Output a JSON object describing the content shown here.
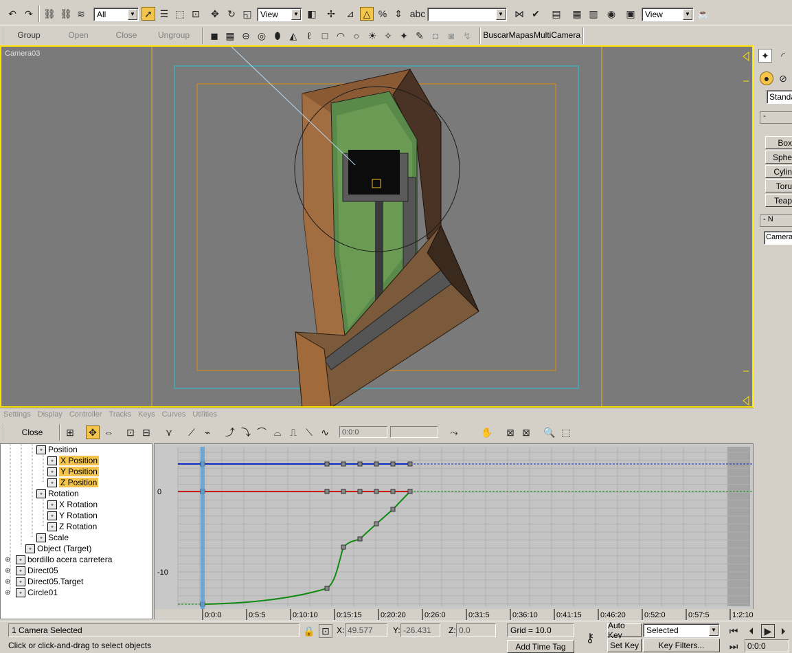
{
  "toolbar_main": {
    "selection_filter": "All",
    "ref_coord": "View",
    "named_selection": "",
    "ref_coord2": "View"
  },
  "toolbar_group": {
    "group": "Group",
    "open": "Open",
    "close": "Close",
    "ungroup": "Ungroup",
    "buscar_mapas": "BuscarMapas",
    "multi_camera": "MultiCamera"
  },
  "viewport": {
    "label": "Camera03"
  },
  "command_panel": {
    "dropdown": "Standa",
    "rollout1_title": "-",
    "buttons": [
      "Box",
      "Sphe",
      "Cylin",
      "Toru",
      "Teap"
    ],
    "rollout2_title": "- N",
    "name_field": "Camera0"
  },
  "track_view_menu": [
    "Settings",
    "Display",
    "Controller",
    "Tracks",
    "Keys",
    "Curves",
    "Utilities"
  ],
  "track_view_toolbar": {
    "close": "Close",
    "frame_field": "0:0:0",
    "value_field": ""
  },
  "tree": [
    {
      "label": "Position",
      "highlight": false,
      "indent": 52
    },
    {
      "label": "X Position",
      "highlight": true,
      "indent": 68
    },
    {
      "label": "Y Position",
      "highlight": true,
      "indent": 68
    },
    {
      "label": "Z Position",
      "highlight": true,
      "indent": 68
    },
    {
      "label": "Rotation",
      "highlight": false,
      "indent": 52
    },
    {
      "label": "X Rotation",
      "highlight": false,
      "indent": 68
    },
    {
      "label": "Y Rotation",
      "highlight": false,
      "indent": 68
    },
    {
      "label": "Z Rotation",
      "highlight": false,
      "indent": 68
    },
    {
      "label": "Scale",
      "highlight": false,
      "indent": 52
    },
    {
      "label": "Object (Target)",
      "highlight": false,
      "indent": 36
    },
    {
      "label": "bordillo acera carretera",
      "highlight": false,
      "indent": 22
    },
    {
      "label": "Direct05",
      "highlight": false,
      "indent": 22
    },
    {
      "label": "Direct05.Target",
      "highlight": false,
      "indent": 22
    },
    {
      "label": "Circle01",
      "highlight": false,
      "indent": 22
    }
  ],
  "curve_editor": {
    "y_labels": [
      "0",
      "-10"
    ],
    "x_ticks": [
      "0:0:0",
      "0:5:5",
      "0:10:10",
      "0:15:15",
      "0:20:20",
      "0:26:0",
      "0:31:5",
      "0:36:10",
      "0:41:15",
      "0:46:20",
      "0:52:0",
      "0:57:5",
      "1:2:10"
    ],
    "curve_colors": {
      "x": "#cc1a1a",
      "y": "#0a2cc0",
      "z": "#108a10"
    }
  },
  "status": {
    "selection": "1 Camera Selected",
    "prompt": "Click or click-and-drag to select objects",
    "x_label": "X:",
    "x_value": "49.577",
    "y_label": "Y:",
    "y_value": "-26.431",
    "z_label": "Z:",
    "z_value": "0.0",
    "grid": "Grid = 10.0",
    "add_time_tag": "Add Time Tag",
    "auto_key": "Auto Key",
    "set_key": "Set Key",
    "key_mode": "Selected",
    "key_filters": "Key Filters...",
    "frame": "0:0:0"
  }
}
